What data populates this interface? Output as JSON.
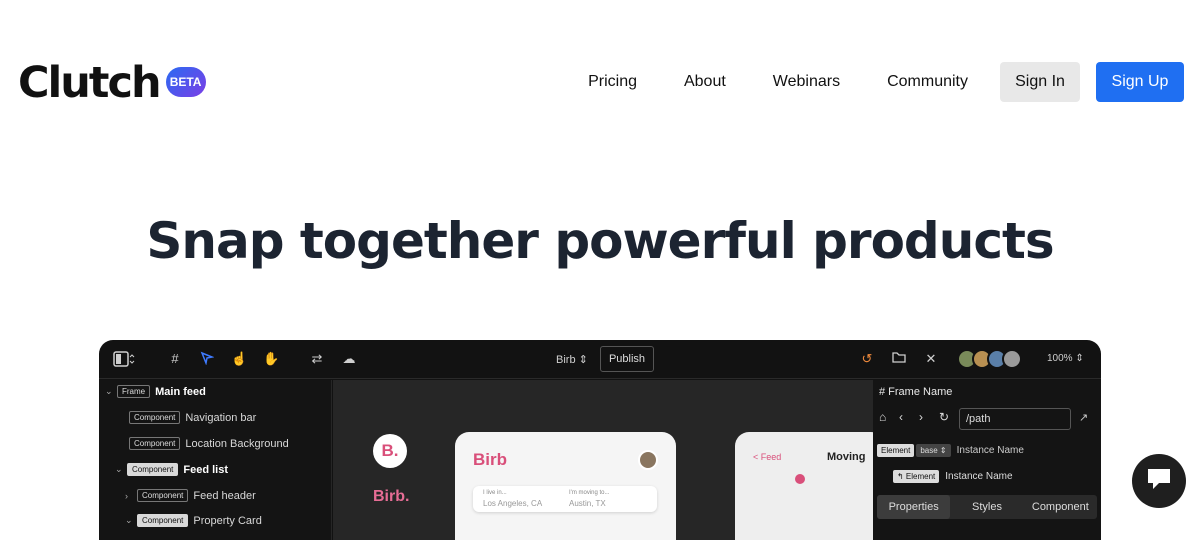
{
  "brand": {
    "name": "Clutch",
    "badge": "BETA"
  },
  "nav": {
    "links": [
      "Pricing",
      "About",
      "Webinars",
      "Community"
    ],
    "sign_in": "Sign In",
    "sign_up": "Sign Up"
  },
  "hero": {
    "title": "Snap together powerful products"
  },
  "editor": {
    "project_name": "Birb",
    "publish_label": "Publish",
    "zoom": "100%",
    "layers": [
      {
        "tag": "Frame",
        "label": "Main feed"
      },
      {
        "tag": "Component",
        "label": "Navigation bar"
      },
      {
        "tag": "Component",
        "label": "Location Background"
      },
      {
        "tag": "Component",
        "label": "Feed list"
      },
      {
        "tag": "Component",
        "label": "Feed header"
      },
      {
        "tag": "Component",
        "label": "Property Card"
      }
    ],
    "canvas": {
      "logo_letter": "B.",
      "logo_word": "Birb.",
      "app_title": "Birb",
      "from_label": "I live in...",
      "from_value": "Los Angeles, CA",
      "to_label": "I'm moving to...",
      "to_value": "Austin, TX",
      "feed_link": "< Feed",
      "moving_label": "Moving"
    },
    "panel": {
      "frame_name": "# Frame Name",
      "path": "/path",
      "element_chip": "Element",
      "base_chip": "base ⇕",
      "instance_name": "Instance Name",
      "child_chip": "↰ Element",
      "child_instance_name": "Instance Name",
      "tabs": [
        "Properties",
        "Styles",
        "Component"
      ]
    }
  }
}
